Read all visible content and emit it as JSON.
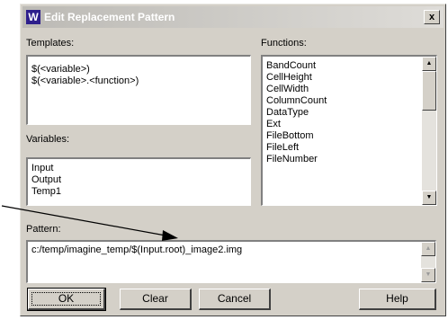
{
  "dialog": {
    "title": "Edit Replacement Pattern",
    "close_label": "x",
    "icon_glyph": "W"
  },
  "templates": {
    "label": "Templates:",
    "items": [
      "$(<variable>)",
      "$(<variable>.<function>)"
    ]
  },
  "functions": {
    "label": "Functions:",
    "items": [
      "BandCount",
      "CellHeight",
      "CellWidth",
      "ColumnCount",
      "DataType",
      "Ext",
      "FileBottom",
      "FileLeft",
      "FileNumber"
    ]
  },
  "variables": {
    "label": "Variables:",
    "items": [
      "Input",
      "Output",
      "Temp1"
    ]
  },
  "pattern": {
    "label": "Pattern:",
    "value": "c:/temp/imagine_temp/$(Input.root)_image2.img"
  },
  "buttons": {
    "ok": "OK",
    "clear": "Clear",
    "cancel": "Cancel",
    "help": "Help"
  },
  "icons": {
    "scroll_up": "triangle-up-icon",
    "scroll_down": "triangle-down-icon",
    "annotation": "arrow-pointer"
  }
}
